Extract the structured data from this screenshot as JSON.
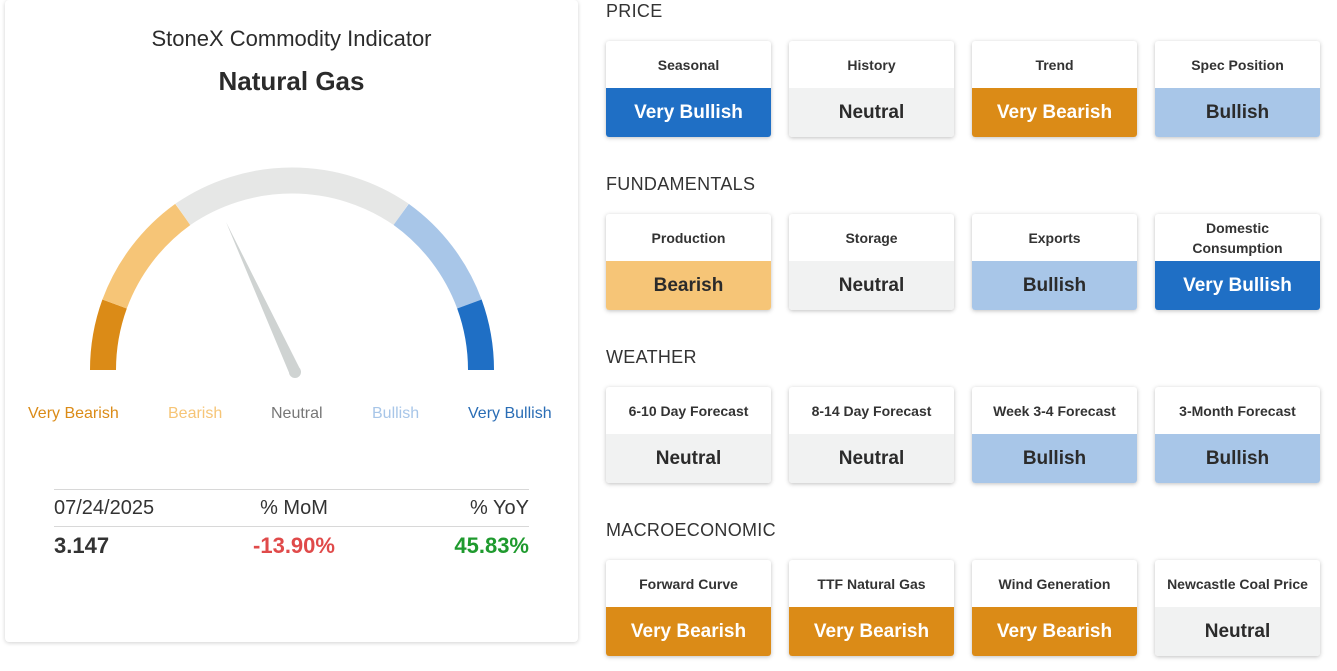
{
  "indicator": {
    "brand_title": "StoneX Commodity Indicator",
    "commodity": "Natural Gas",
    "gauge": {
      "labels": [
        "Very Bearish",
        "Bearish",
        "Neutral",
        "Bullish",
        "Very Bullish"
      ],
      "label_colors": [
        "#db8b17",
        "#f6c577",
        "#777777",
        "#a8c6e8",
        "#2a6db5"
      ],
      "segment_colors": [
        "#db8b17",
        "#f6c577",
        "#e6e7e6",
        "#a8c6e8",
        "#1f6fc5"
      ],
      "needle_color": "#cfd3d2",
      "needle_reading": "Bearish"
    },
    "stats": {
      "date_header": "07/24/2025",
      "mom_header": "% MoM",
      "yoy_header": "% YoY",
      "price": "3.147",
      "mom_value": "-13.90%",
      "yoy_value": "45.83%"
    }
  },
  "sections": [
    {
      "title": "PRICE",
      "tiles": [
        {
          "name": "Seasonal",
          "value": "Very Bullish",
          "level": "vbull"
        },
        {
          "name": "History",
          "value": "Neutral",
          "level": "neut"
        },
        {
          "name": "Trend",
          "value": "Very Bearish",
          "level": "vbear"
        },
        {
          "name": "Spec Position",
          "value": "Bullish",
          "level": "bull"
        }
      ]
    },
    {
      "title": "FUNDAMENTALS",
      "tiles": [
        {
          "name": "Production",
          "value": "Bearish",
          "level": "bear"
        },
        {
          "name": "Storage",
          "value": "Neutral",
          "level": "neut"
        },
        {
          "name": "Exports",
          "value": "Bullish",
          "level": "bull"
        },
        {
          "name": "Domestic Consumption",
          "value": "Very Bullish",
          "level": "vbull"
        }
      ]
    },
    {
      "title": "WEATHER",
      "tiles": [
        {
          "name": "6-10 Day Forecast",
          "value": "Neutral",
          "level": "neut"
        },
        {
          "name": "8-14 Day Forecast",
          "value": "Neutral",
          "level": "neut"
        },
        {
          "name": "Week 3-4 Forecast",
          "value": "Bullish",
          "level": "bull"
        },
        {
          "name": "3-Month Forecast",
          "value": "Bullish",
          "level": "bull"
        }
      ]
    },
    {
      "title": "MACROECONOMIC",
      "tiles": [
        {
          "name": "Forward Curve",
          "value": "Very Bearish",
          "level": "vbear"
        },
        {
          "name": "TTF Natural Gas",
          "value": "Very Bearish",
          "level": "vbear"
        },
        {
          "name": "Wind Generation",
          "value": "Very Bearish",
          "level": "vbear"
        },
        {
          "name": "Newcastle Coal Price",
          "value": "Neutral",
          "level": "neut"
        }
      ]
    }
  ]
}
